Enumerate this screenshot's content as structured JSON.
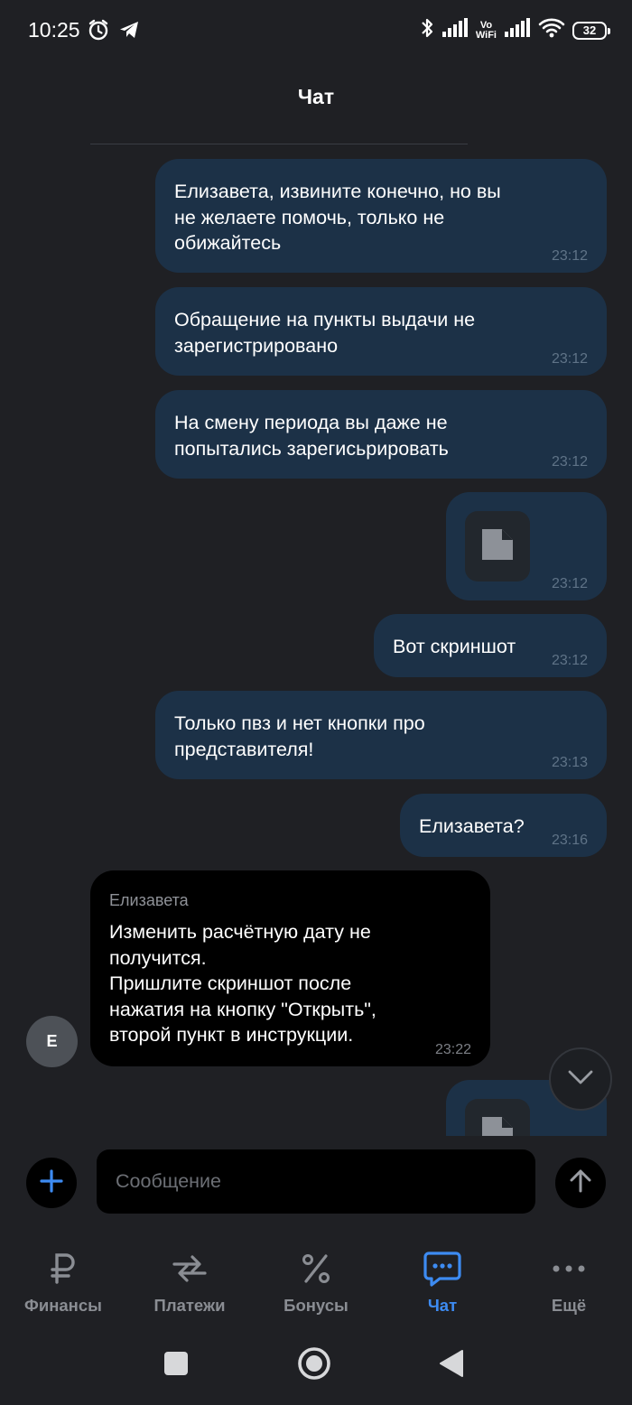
{
  "status_bar": {
    "time": "10:25",
    "vowifi_top": "Vo",
    "vowifi_bottom": "WiFi",
    "battery": "32"
  },
  "header": {
    "title": "Чат"
  },
  "messages": [
    {
      "direction": "out",
      "text": "Елизавета, извините конечно, но вы\nне желаете помочь, только не\nобижайтесь",
      "time": "23:12"
    },
    {
      "direction": "out",
      "text": "Обращение на пункты выдачи не\nзарегистрировано",
      "time": "23:12"
    },
    {
      "direction": "out",
      "text": "На смену периода вы даже не\nпопытались зарегисьрировать",
      "time": "23:12"
    },
    {
      "direction": "out",
      "type": "file",
      "icon": "file-icon",
      "time": "23:12"
    },
    {
      "direction": "out",
      "text": "Вот скриншот",
      "time": "23:12"
    },
    {
      "direction": "out",
      "text": "Только пвз и нет кнопки про\nпредставителя!",
      "time": "23:13"
    },
    {
      "direction": "out",
      "text": "Елизавета?",
      "time": "23:16"
    },
    {
      "direction": "in",
      "sender": "Елизавета",
      "avatar_letter": "Е",
      "text": "Изменить расчётную дату не\nполучится.\nПришлите скриншот после\nнажатия на кнопку \"Открыть\",\nвторой пункт в инструкции.",
      "time": "23:22"
    },
    {
      "direction": "out",
      "type": "file",
      "icon": "file-icon",
      "partially_visible": true
    }
  ],
  "composer": {
    "placeholder": "Сообщение"
  },
  "bottom_nav": [
    {
      "label": "Финансы",
      "icon": "ruble-icon",
      "active": false
    },
    {
      "label": "Платежи",
      "icon": "transfer-arrows-icon",
      "active": false
    },
    {
      "label": "Бонусы",
      "icon": "percent-icon",
      "active": false
    },
    {
      "label": "Чат",
      "icon": "chat-bubble-icon",
      "active": true
    },
    {
      "label": "Ещё",
      "icon": "more-dots-icon",
      "active": false
    }
  ],
  "colors": {
    "background": "#1f2024",
    "outgoing_bubble": "#1c3147",
    "incoming_bubble": "#000000",
    "accent": "#3d8bf2",
    "muted_text": "#8a8d93"
  }
}
